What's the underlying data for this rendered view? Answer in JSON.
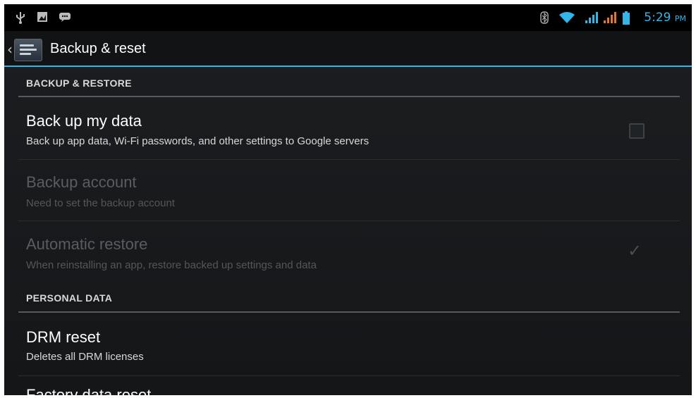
{
  "status_bar": {
    "left_icons": [
      "usb-icon",
      "image-notification-icon",
      "chat-notification-icon"
    ],
    "right_icons": [
      "bluetooth-icon",
      "wifi-icon",
      "signal-sim1-icon",
      "signal-sim2-icon",
      "battery-icon"
    ],
    "time": "5:29",
    "ampm": "PM",
    "accent_color": "#33b5e5"
  },
  "action_bar": {
    "title": "Backup & reset",
    "back_icon": "chevron-left-icon",
    "app_icon": "backup-settings-icon"
  },
  "sections": {
    "backup_restore": {
      "header": "BACKUP & RESTORE",
      "backup_data": {
        "title": "Back up my data",
        "summary": "Back up app data, Wi-Fi passwords, and other settings to Google servers",
        "checked": false
      },
      "backup_account": {
        "title": "Backup account",
        "summary": "Need to set the backup account",
        "enabled": false
      },
      "auto_restore": {
        "title": "Automatic restore",
        "summary": "When reinstalling an app, restore backed up settings and data",
        "checked": true,
        "enabled": false
      }
    },
    "personal_data": {
      "header": "PERSONAL DATA",
      "drm_reset": {
        "title": "DRM reset",
        "summary": "Deletes all DRM licenses"
      },
      "factory_reset": {
        "title": "Factory data reset"
      }
    }
  }
}
